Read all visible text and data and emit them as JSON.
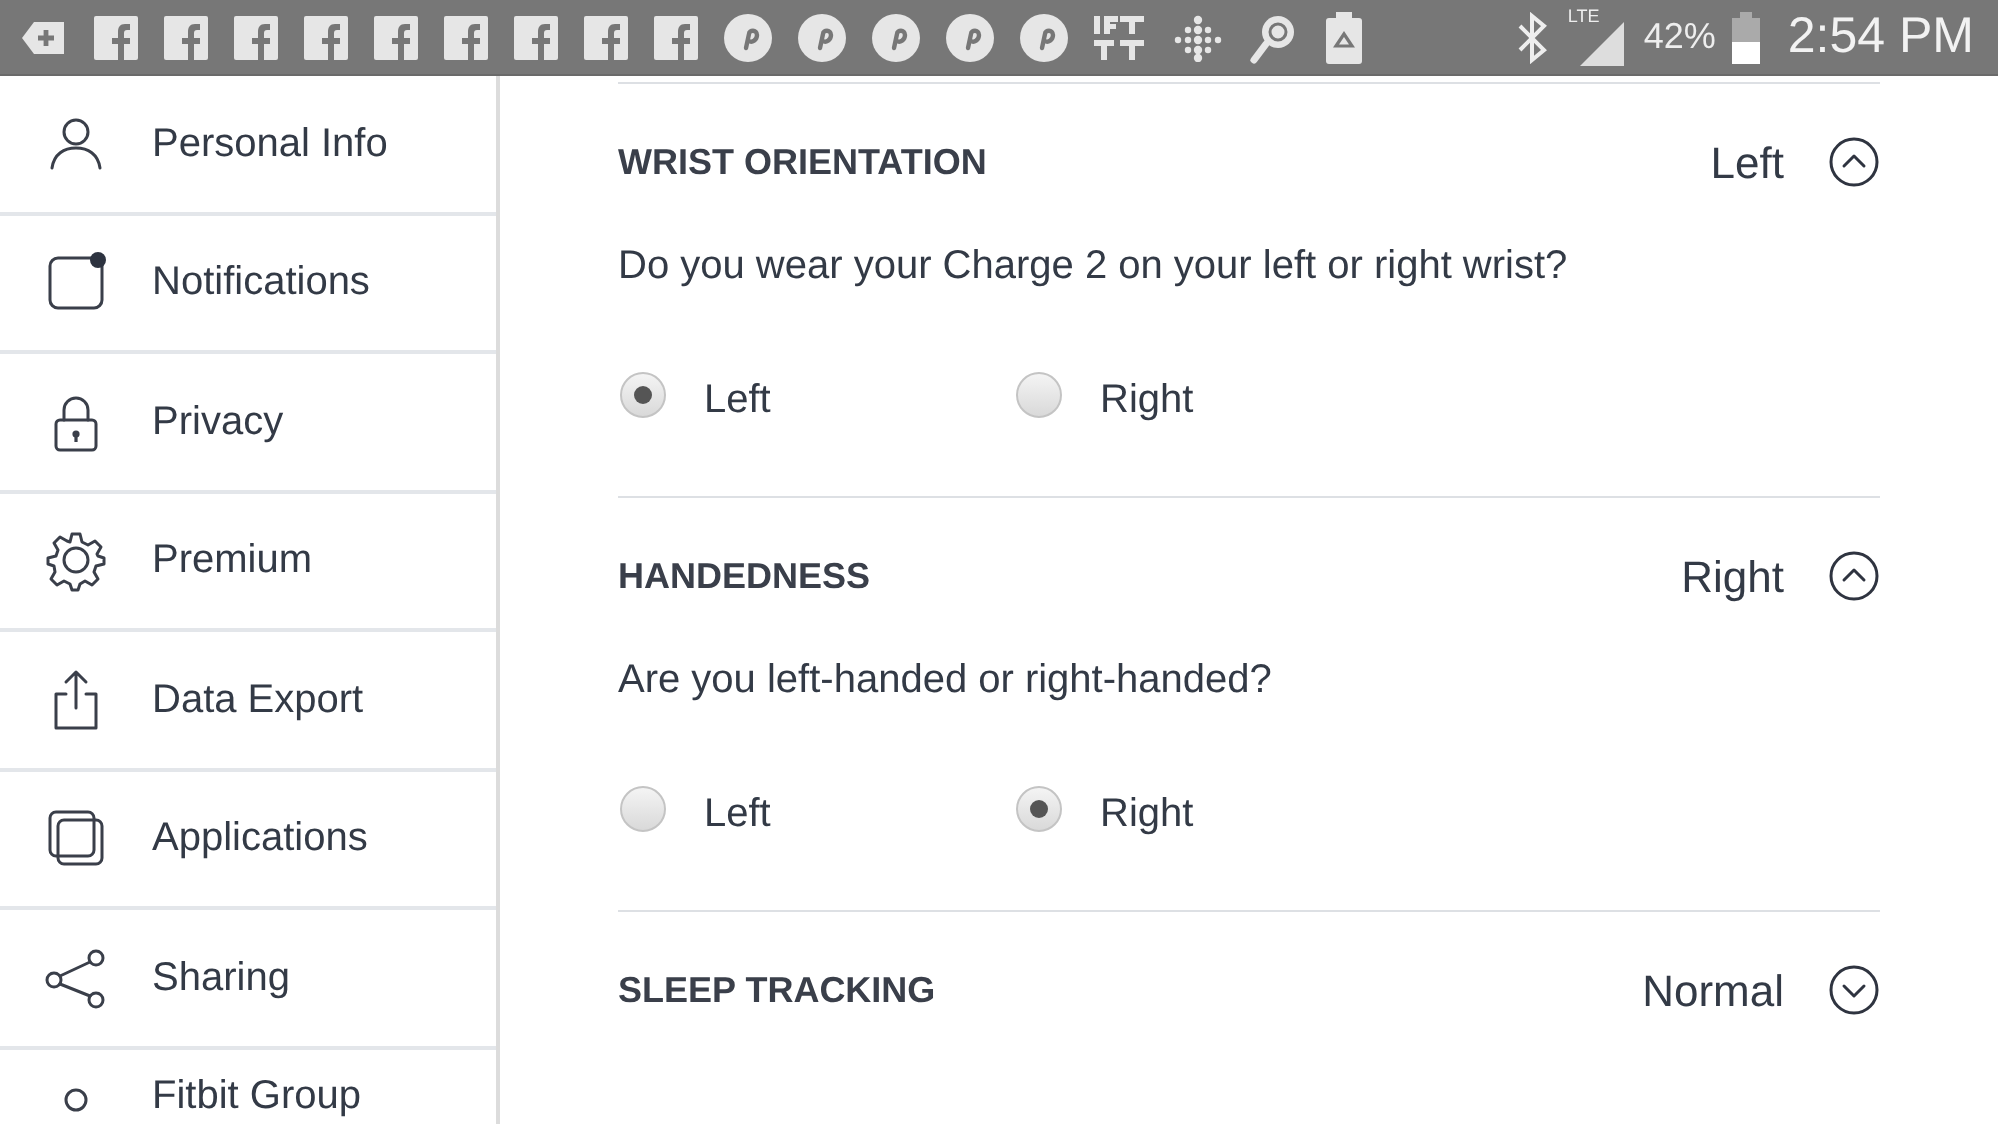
{
  "status_bar": {
    "network": "LTE",
    "battery": "42%",
    "time": "2:54 PM"
  },
  "sidebar": {
    "items": [
      {
        "label": "Personal Info"
      },
      {
        "label": "Notifications"
      },
      {
        "label": "Privacy"
      },
      {
        "label": "Premium"
      },
      {
        "label": "Data Export"
      },
      {
        "label": "Applications"
      },
      {
        "label": "Sharing"
      },
      {
        "label": "Fitbit Group"
      }
    ]
  },
  "sections": [
    {
      "title": "WRIST ORIENTATION",
      "value": "Left",
      "expanded": true,
      "question": "Do you wear your Charge 2 on your left or right wrist?",
      "options": [
        {
          "label": "Left",
          "selected": true
        },
        {
          "label": "Right",
          "selected": false
        }
      ]
    },
    {
      "title": "HANDEDNESS",
      "value": "Right",
      "expanded": true,
      "question": "Are you left-handed or right-handed?",
      "options": [
        {
          "label": "Left",
          "selected": false
        },
        {
          "label": "Right",
          "selected": true
        }
      ]
    },
    {
      "title": "SLEEP TRACKING",
      "value": "Normal",
      "expanded": false
    }
  ]
}
